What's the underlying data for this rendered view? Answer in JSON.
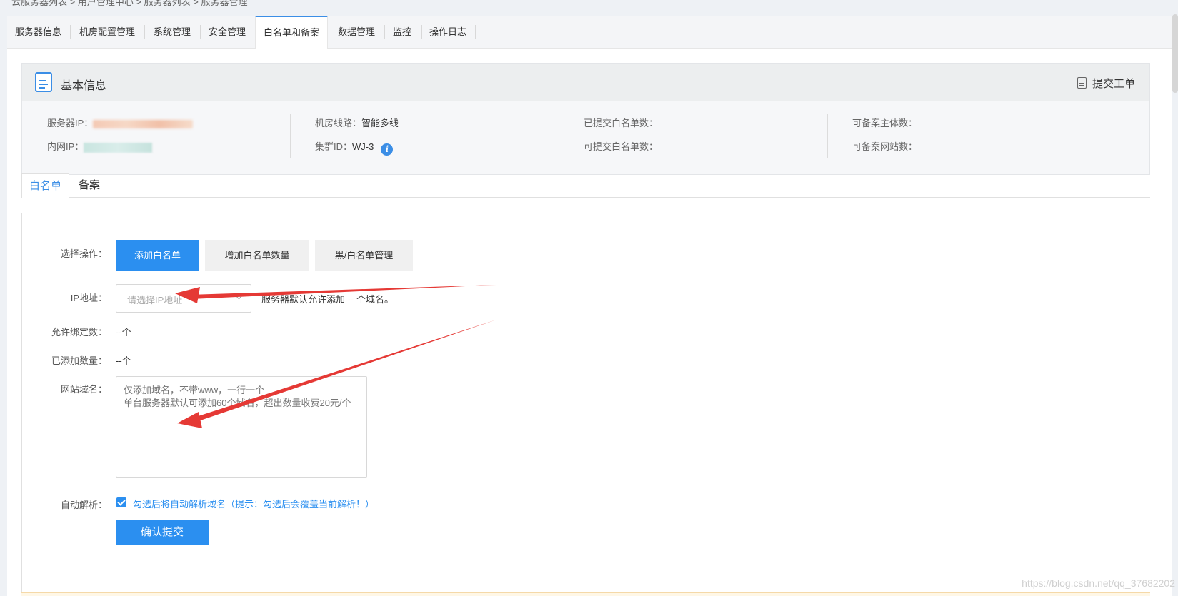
{
  "breadcrumb": "云服务器列表  >  用户管理中心  >  服务器列表  >  服务器管理",
  "tabs": [
    "服务器信息",
    "机房配置管理",
    "系统管理",
    "安全管理",
    "白名单和备案",
    "数据管理",
    "监控",
    "操作日志"
  ],
  "info": {
    "title": "基本信息",
    "ticket_label": "提交工单",
    "server_ip_label": "服务器IP：",
    "intranet_ip_label": "内网IP：",
    "line_label": "机房线路：",
    "line_value": "智能多线",
    "cluster_label": "集群ID：",
    "cluster_value": "WJ-3",
    "submitted_label": "已提交白名单数：",
    "submittable_label": "可提交白名单数：",
    "record_subject_label": "可备案主体数：",
    "record_site_label": "可备案网站数："
  },
  "subtabs": [
    "白名单",
    "备案"
  ],
  "form": {
    "operation_label": "选择操作：",
    "btn_add": "添加白名单",
    "btn_increase": "增加白名单数量",
    "btn_manage": "黑/白名单管理",
    "ip_label": "IP地址：",
    "ip_placeholder": "请选择IP地址",
    "ip_hint_before": "服务器默认允许添加",
    "ip_hint_value": "--",
    "ip_hint_after": "个域名。",
    "allowed_label": "允许绑定数：",
    "allowed_value": "--个",
    "added_label": "已添加数量：",
    "added_value": "--个",
    "domain_label": "网站域名：",
    "domain_placeholder": "仅添加域名，不带www，一行一个\n单台服务器默认可添加60个域名，超出数量收费20元/个",
    "auto_label": "自动解析：",
    "auto_checked": true,
    "auto_text": "勾选后将自动解析域名（提示：勾选后会覆盖当前解析！）",
    "submit": "确认提交"
  },
  "watermark": "https://blog.csdn.net/qq_37682202",
  "colors": {
    "accent": "#2b8ff0",
    "arrow": "#e53935"
  }
}
